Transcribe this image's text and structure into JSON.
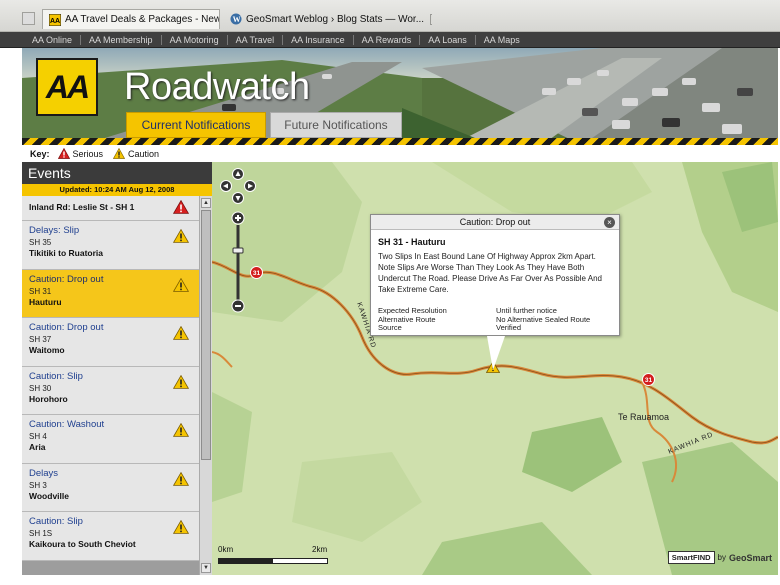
{
  "browser": {
    "tabs": [
      {
        "title": "AA Travel Deals & Packages - New Ze..."
      },
      {
        "title": "GeoSmart Weblog › Blog Stats — Wor..."
      }
    ]
  },
  "site_nav": [
    "AA Online",
    "AA Membership",
    "AA Motoring",
    "AA Travel",
    "AA Insurance",
    "AA Rewards",
    "AA Loans",
    "AA Maps"
  ],
  "banner": {
    "logo_text": "AA",
    "brand": "Roadwatch",
    "tabs": {
      "current": "Current Notifications",
      "future": "Future Notifications"
    }
  },
  "key": {
    "label": "Key:",
    "serious": "Serious",
    "caution": "Caution"
  },
  "events": {
    "heading": "Events",
    "updated": "Updated: 10:24 AM Aug 12, 2008",
    "items": [
      {
        "title": "Inland Rd: Leslie St - SH 1",
        "road": "",
        "place": "",
        "severity": "serious"
      },
      {
        "title": "Delays: Slip",
        "road": "SH 35",
        "place": "Tikitiki to Ruatoria",
        "severity": "caution"
      },
      {
        "title": "Caution: Drop out",
        "road": "SH 31",
        "place": "Hauturu",
        "severity": "caution"
      },
      {
        "title": "Caution: Drop out",
        "road": "SH 37",
        "place": "Waitomo",
        "severity": "caution"
      },
      {
        "title": "Caution: Slip",
        "road": "SH 30",
        "place": "Horohoro",
        "severity": "caution"
      },
      {
        "title": "Caution: Washout",
        "road": "SH 4",
        "place": "Aria",
        "severity": "caution"
      },
      {
        "title": "Delays",
        "road": "SH 3",
        "place": "Woodville",
        "severity": "caution"
      },
      {
        "title": "Caution: Slip",
        "road": "SH 1S",
        "place": "Kaikoura to South Cheviot",
        "severity": "caution"
      }
    ],
    "selected_index": 2
  },
  "popup": {
    "header": "Caution: Drop out",
    "title": "SH 31 - Hauturu",
    "description": "Two Slips In East Bound Lane Of Highway Approx 2km Apart. Note Slips Are Worse Than They Look As They Have Both Undercut The Road. Please Drive As Far Over As Possible And Take Extreme Care.",
    "fields": [
      {
        "label": "Expected Resolution",
        "value": "Until further notice"
      },
      {
        "label": "Alternative Route",
        "value": "No Alternative Sealed Route"
      },
      {
        "label": "Source",
        "value": "Verified"
      }
    ]
  },
  "map": {
    "labels": {
      "road": "KAWHIA RD",
      "road2": "KAWHIA RD",
      "town": "Te Rauamoa"
    },
    "shields": [
      "31",
      "31"
    ],
    "scale": {
      "start": "0km",
      "end": "2km"
    },
    "attribution": {
      "smartfind": "SmartFIND",
      "by": "by",
      "geosmart": "GeoSmart"
    }
  },
  "colors": {
    "accent": "#f5c400",
    "serious": "#d71f1f",
    "nav_bg": "#3f3f3f",
    "link": "#1f3f8f"
  }
}
